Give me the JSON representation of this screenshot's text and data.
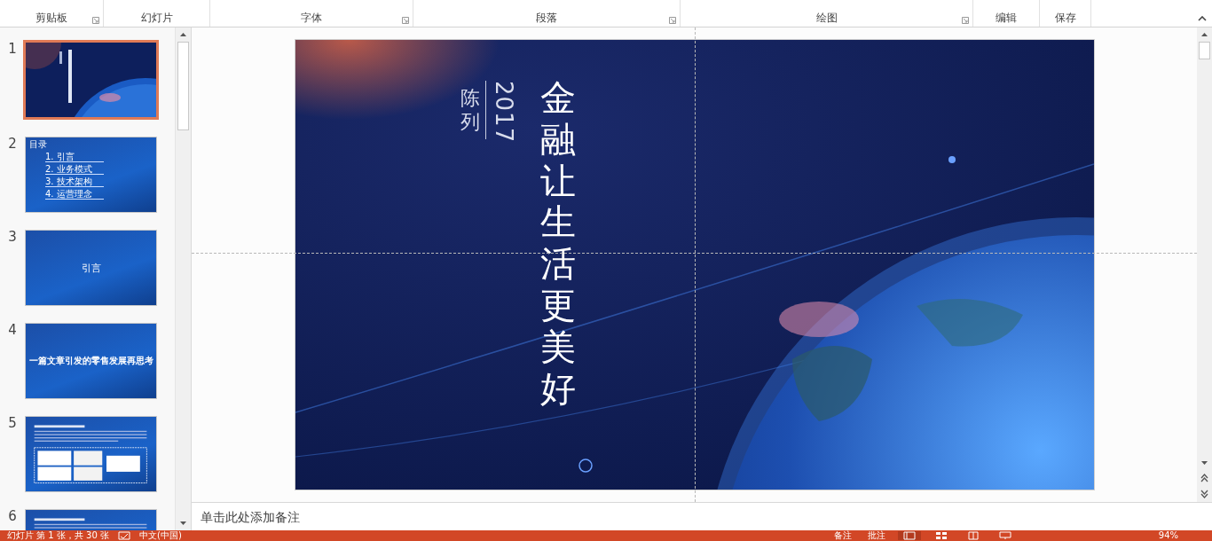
{
  "ribbon": {
    "groups": [
      {
        "label": "剪贴板",
        "launcher": true
      },
      {
        "label": "幻灯片",
        "launcher": false
      },
      {
        "label": "字体",
        "launcher": true
      },
      {
        "label": "段落",
        "launcher": true
      },
      {
        "label": "绘图",
        "launcher": true
      },
      {
        "label": "编辑",
        "launcher": false
      },
      {
        "label": "保存",
        "launcher": false
      }
    ]
  },
  "slides_panel": {
    "slides": [
      {
        "number": "1",
        "selected": true,
        "kind": "cover"
      },
      {
        "number": "2",
        "selected": false,
        "kind": "toc",
        "title": "目录",
        "lines": [
          "1. 引言",
          "2. 业务模式",
          "3. 技术架构",
          "4. 运营理念"
        ]
      },
      {
        "number": "3",
        "selected": false,
        "kind": "section",
        "title": "引言"
      },
      {
        "number": "4",
        "selected": false,
        "kind": "heading",
        "title": "一篇文章引发的零售发展再思考"
      },
      {
        "number": "5",
        "selected": false,
        "kind": "content"
      },
      {
        "number": "6",
        "selected": false,
        "kind": "content"
      }
    ]
  },
  "slide": {
    "author": "陈列",
    "year": "2017",
    "title": "金融让生活更美好"
  },
  "notes": {
    "placeholder": "单击此处添加备注"
  },
  "status_bar": {
    "slide_info": "幻灯片 第 1 张，共 30 张",
    "language": "中文(中国)",
    "notes_button": "备注",
    "comments_button": "批注",
    "zoom": "94%"
  }
}
